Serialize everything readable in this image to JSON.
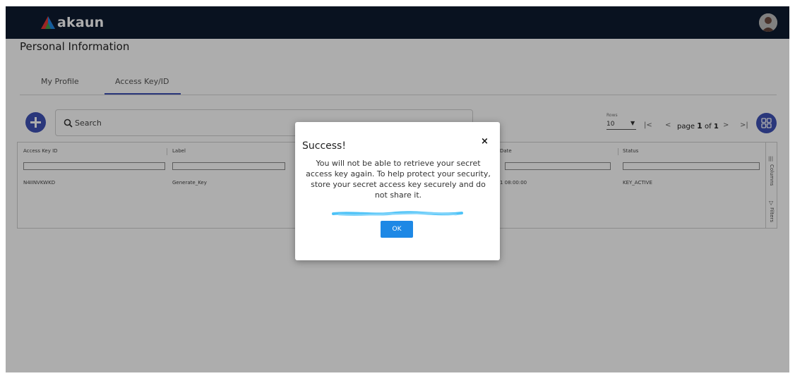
{
  "header": {
    "logo_text": "akaun",
    "logo_icon": "akaun-triangle-logo",
    "avatar_icon": "user-avatar"
  },
  "page": {
    "title": "Personal Information"
  },
  "tabs": [
    {
      "label": "My Profile",
      "active": false
    },
    {
      "label": "Access Key/ID",
      "active": true
    }
  ],
  "toolbar": {
    "add_icon": "plus-icon",
    "search_placeholder": "Search",
    "rows_label": "Rows",
    "rows_value": "10",
    "first_page_icon": "|<",
    "prev_page_icon": "<",
    "page_prefix": "page",
    "page_current": "1",
    "page_of": "of",
    "page_total": "1",
    "next_page_icon": ">",
    "last_page_icon": ">|",
    "grid_icon": "grid-view-icon"
  },
  "table": {
    "columns": [
      "Access Key ID",
      "Label",
      "Date",
      "Status"
    ],
    "rows": [
      {
        "access_key_id": "N4IINVKWKD",
        "label": "Generate_Key",
        "date": "1 08:00:00",
        "status": "KEY_ACTIVE"
      }
    ],
    "side_panel": {
      "columns_label": "Columns",
      "filters_label": "Filters"
    }
  },
  "modal": {
    "title": "Success!",
    "close_glyph": "×",
    "body": "You will not be able to retrieve your secret access key again. To help protect your security, store your secret access key securely and do not share it.",
    "ok_label": "OK"
  },
  "colors": {
    "topbar": "#0e1b30",
    "accent": "#3f51b5",
    "ok_button": "#1e88e5",
    "redaction": "#4fc3f7"
  }
}
